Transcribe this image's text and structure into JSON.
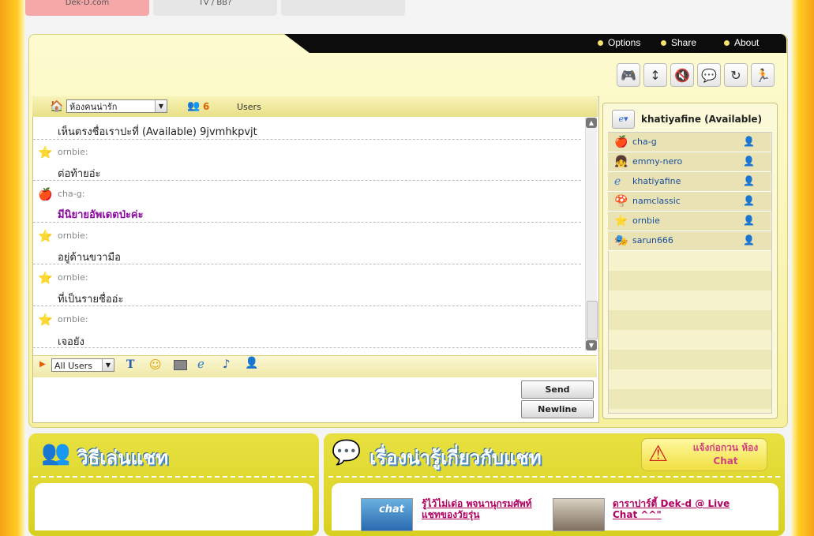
{
  "top_tabs": [
    {
      "label": "Dek-D.com",
      "color": "#f4a0a0"
    },
    {
      "label": "TV / BB?",
      "color": "#e8e8e8"
    },
    {
      "label": "",
      "color": "#e8e8e8"
    }
  ],
  "menu": {
    "options": "Options",
    "share": "Share",
    "about": "About"
  },
  "toolbar_icons": [
    "game-icon",
    "resize-icon",
    "mute-icon",
    "bubble-icon",
    "refresh-icon",
    "exit-icon"
  ],
  "room": {
    "name": "ห้องคนน่ารัก",
    "user_count": "6",
    "users_label": "Users"
  },
  "messages": [
    {
      "user": "",
      "text": "เห็นตรงชื่อเราปะที่ (Available) 9jvmhkpvjt",
      "icon": "",
      "highlight": false
    },
    {
      "user": "ornbie:",
      "text": "ต่อท้ายอ่ะ",
      "icon": "star-icon",
      "highlight": false
    },
    {
      "user": "cha-g:",
      "text": "มีนิยายอัพเดตป่ะค่ะ",
      "icon": "apple-icon",
      "highlight": true
    },
    {
      "user": "ornbie:",
      "text": "อยู่ด้านขวามือ",
      "icon": "star-icon",
      "highlight": false
    },
    {
      "user": "ornbie:",
      "text": "ที่เป็นรายชื่ออ่ะ",
      "icon": "star-icon",
      "highlight": false
    },
    {
      "user": "ornbie:",
      "text": "เจอยัง",
      "icon": "star-icon",
      "highlight": false
    }
  ],
  "input": {
    "recipient": "All Users",
    "send": "Send",
    "newline": "Newline"
  },
  "current_user": {
    "label": "khatiyafine (Available)"
  },
  "users": [
    {
      "name": "cha-g",
      "icon": "apple-icon",
      "gender": "male"
    },
    {
      "name": "emmy-nero",
      "icon": "girl-icon",
      "gender": "female"
    },
    {
      "name": "khatiyafine",
      "icon": "ie-icon",
      "gender": "male"
    },
    {
      "name": "namclassic",
      "icon": "mushroom-icon",
      "gender": "male"
    },
    {
      "name": "ornbie",
      "icon": "star-icon",
      "gender": "male"
    },
    {
      "name": "sarun666",
      "icon": "mask-icon",
      "gender": "male"
    }
  ],
  "bottom": {
    "howto_title": "วิธีเล่นแชท",
    "about_title": "เรื่องน่ารู้เกี่ยวกับแชท",
    "notify_label": "แจ้งก่อกวน ห้อง Chat",
    "chat_thumb_label": "chat",
    "article1_title": "รู้ไว้ไม่เด่อ พจนานุกรมศัพท์แชทของวัยรุ่น",
    "article2_title": "ดาราปาร์ตี้ Dek-d @ Live Chat ^^\""
  },
  "colors": {
    "accent_yellow": "#f0e860",
    "highlight_text": "#8a0aa0",
    "username_blue": "#1a4d9a"
  }
}
